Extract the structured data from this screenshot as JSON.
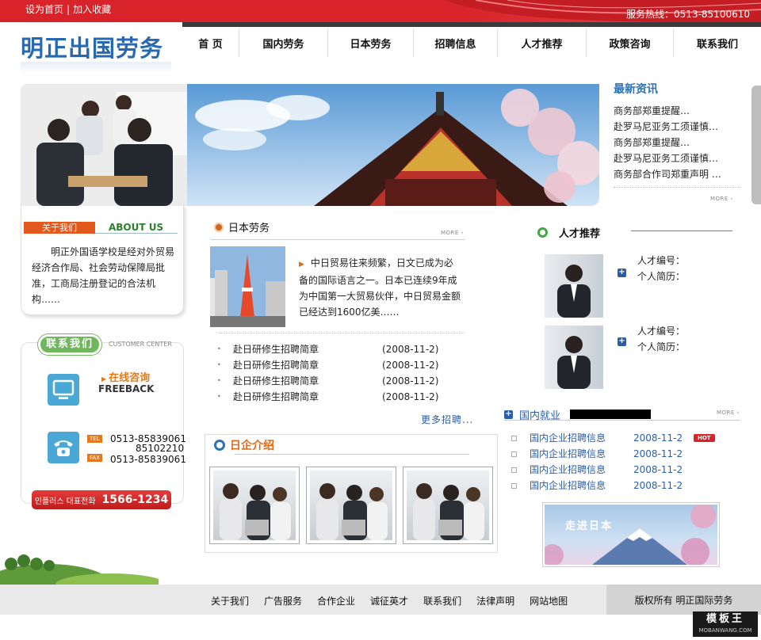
{
  "topbar": {
    "links": [
      "设为首页",
      "加入收藏"
    ],
    "separator": "|",
    "hotline": "服务热线：0513-85100610"
  },
  "logo": "明正出国劳务",
  "nav": [
    "首 页",
    "国内劳务",
    "日本劳务",
    "招聘信息",
    "人才推荐",
    "政策咨询",
    "联系我们"
  ],
  "news": {
    "title": "最新资讯",
    "items": [
      "商务部郑重提醒…",
      "赴罗马尼亚务工须谨慎…",
      "商务部郑重提醒…",
      "赴罗马尼亚务工须谨慎…",
      "商务部合作司郑重声明 …"
    ],
    "more": "MORE"
  },
  "about": {
    "tag": "关于我们",
    "en": "ABOUT US",
    "text": "明正外国语学校是经对外贸易经济合作局、社会劳动保障局批准，工商局注册登记的合法机构……"
  },
  "contact": {
    "badge": "联系我们",
    "customer_center": "CUSTOMER CENTER",
    "online": "在线咨询",
    "freeback": "FREEBACK",
    "tel_tag": "TEL",
    "tel_numbers": [
      "0513-85839061",
      "85102210"
    ],
    "fax_tag": "FAX",
    "fax_number": "0513-85839061",
    "hotline_kr": "인플러스 대표전화",
    "hotline_num": "1566-1234"
  },
  "japan_labor": {
    "title": "日本劳务",
    "more": "MORE",
    "desc": "中日贸易往来频繁，日文已成为必备的国际语言之一。日本已连续9年成为中国第一大贸易伙伴，中日贸易金额已经达到1600亿美……",
    "list": [
      {
        "title": "赴日研修生招聘简章",
        "date": "(2008-11-2)"
      },
      {
        "title": "赴日研修生招聘简章",
        "date": "(2008-11-2)"
      },
      {
        "title": "赴日研修生招聘简章",
        "date": "(2008-11-2)"
      },
      {
        "title": "赴日研修生招聘简章",
        "date": "(2008-11-2)"
      }
    ],
    "more_jobs": "更多招聘..."
  },
  "japan_companies": {
    "title": "日企介绍"
  },
  "talent": {
    "title": "人才推荐",
    "entries": [
      {
        "id_label": "人才编号：",
        "resume_label": "个人简历："
      },
      {
        "id_label": "人才编号：",
        "resume_label": "个人简历："
      }
    ]
  },
  "domestic": {
    "title": "国内就业",
    "more": "MORE",
    "list": [
      {
        "title": "国内企业招聘信息",
        "date": "2008-11-2",
        "hot": "HOT"
      },
      {
        "title": "国内企业招聘信息",
        "date": "2008-11-2"
      },
      {
        "title": "国内企业招聘信息",
        "date": "2008-11-2"
      },
      {
        "title": "国内企业招聘信息",
        "date": "2008-11-2"
      }
    ],
    "banner": "走进日本"
  },
  "footer": {
    "links": [
      "关于我们",
      "广告服务",
      "合作企业",
      "诚征英才",
      "联系我们",
      "法律声明",
      "网站地图"
    ],
    "copyright": "版权所有  明正国际劳务"
  },
  "watermark": {
    "name": "模板王",
    "url": "MOBANWANG.COM"
  }
}
